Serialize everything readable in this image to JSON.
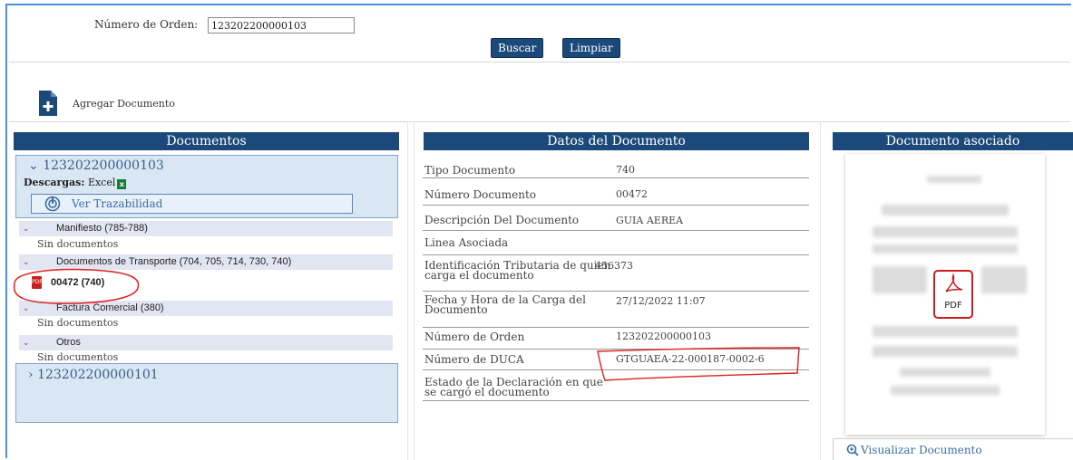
{
  "search": {
    "order_label": "Número de Orden:",
    "order_value": "123202200000103",
    "buscar_label": "Buscar",
    "limpiar_label": "Limpiar"
  },
  "toolbar": {
    "add_document_label": "Agregar Documento"
  },
  "documentos_panel": {
    "title": "Documentos",
    "orders": [
      {
        "number": "123202200000103",
        "expanded": true,
        "descargas_label": "Descargas:",
        "excel_label": "Excel",
        "trazabilidad_label": "Ver Trazabilidad"
      },
      {
        "number": "123202200000101",
        "expanded": false
      }
    ],
    "categories": [
      {
        "label": "Manifiesto (785-788)",
        "empty_text": "Sin documentos"
      },
      {
        "label": "Documentos de Transporte (704, 705, 714, 730, 740)",
        "document": "00472 (740)"
      },
      {
        "label": "Factura Comercial (380)",
        "empty_text": "Sin documentos"
      },
      {
        "label": "Otros",
        "empty_text": "Sin documentos"
      }
    ]
  },
  "datos_panel": {
    "title": "Datos del Documento",
    "rows": [
      {
        "label": "Tipo Documento",
        "value": "740"
      },
      {
        "label": "Número Documento",
        "value": "00472"
      },
      {
        "label": "Descripción Del Documento",
        "value": "GUIA AEREA"
      },
      {
        "label": "Linea Asociada",
        "value": ""
      },
      {
        "label": "Identificación Tributaria de quien carga el documento",
        "value": "456373"
      },
      {
        "label": "Fecha y Hora de la Carga del Documento",
        "value": "27/12/2022 11:07"
      },
      {
        "label": "Número de Orden",
        "value": "123202200000103"
      },
      {
        "label": "Número de DUCA",
        "value": "GTGUAEA-22-000187-0002-6"
      },
      {
        "label": "Estado de la Declaración en que se cargó el documento",
        "value": ""
      }
    ]
  },
  "asociado_panel": {
    "title": "Documento asociado",
    "file_type": "PDF",
    "visualizar_label": "Visualizar Documento"
  },
  "colors": {
    "header_bg": "#1b4a7a",
    "tree_node_bg": "#d9e7f4",
    "category_bg": "#e2e6f3",
    "link": "#3a6ea5",
    "annotation": "#e02020"
  }
}
